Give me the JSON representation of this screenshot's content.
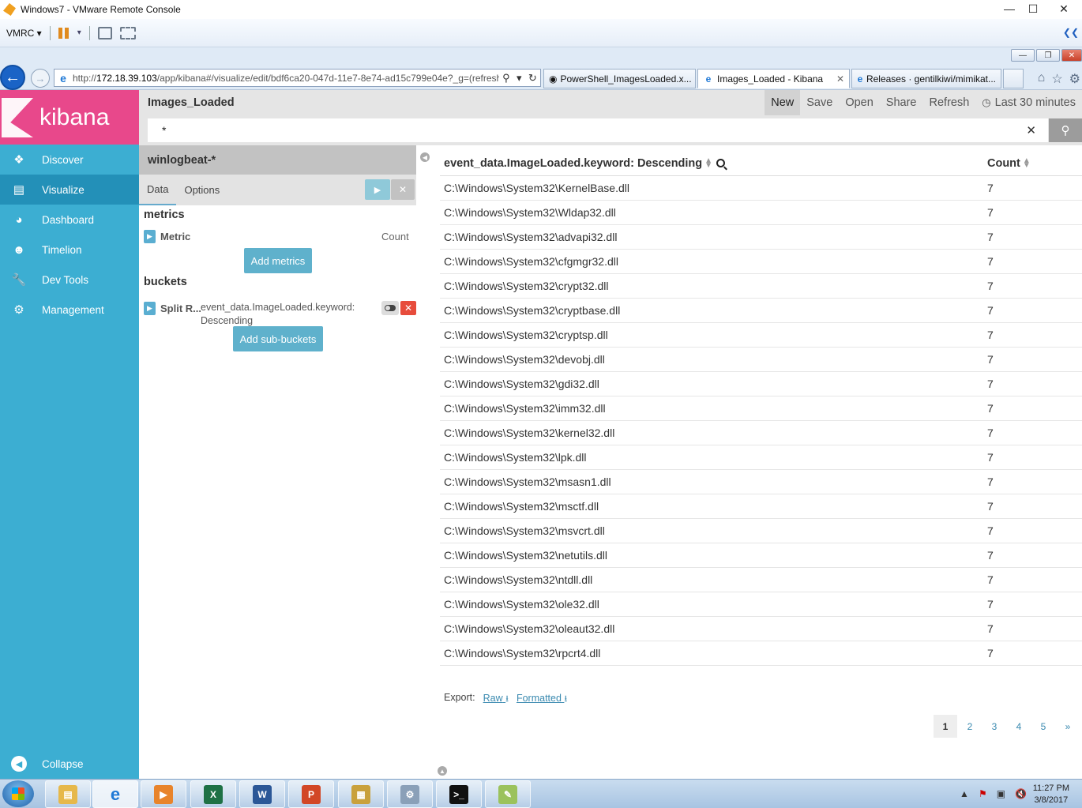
{
  "window": {
    "title": "Windows7 - VMware Remote Console"
  },
  "vm_toolbar": {
    "menu_label": "VMRC"
  },
  "browser": {
    "address_prefix": "http://",
    "address_host": "172.18.39.103",
    "address_path": "/app/kibana#/visualize/edit/bdf6ca20-047d-11e7-8e74-ad15c799e04e?_g=(refresh",
    "tabs": [
      {
        "label": "PowerShell_ImagesLoaded.x...",
        "icon": "github-icon",
        "active": false
      },
      {
        "label": "Images_Loaded - Kibana",
        "icon": "ie-icon",
        "active": true
      },
      {
        "label": "Releases · gentilkiwi/mimikat...",
        "icon": "ie-icon",
        "active": false
      }
    ]
  },
  "kibana": {
    "brand": "kibana",
    "nav": [
      {
        "label": "Discover",
        "icon": "compass-icon",
        "active": false
      },
      {
        "label": "Visualize",
        "icon": "bar-chart-icon",
        "active": true
      },
      {
        "label": "Dashboard",
        "icon": "dashboard-icon",
        "active": false
      },
      {
        "label": "Timelion",
        "icon": "timelion-icon",
        "active": false
      },
      {
        "label": "Dev Tools",
        "icon": "wrench-icon",
        "active": false
      },
      {
        "label": "Management",
        "icon": "gear-icon",
        "active": false
      }
    ],
    "collapse_label": "Collapse",
    "vis_title": "Images_Loaded",
    "menu": [
      "New",
      "Save",
      "Open",
      "Share",
      "Refresh"
    ],
    "time_range": "Last 30 minutes",
    "query": "*",
    "index_pattern": "winlogbeat-*",
    "editor_tabs": [
      "Data",
      "Options"
    ],
    "metrics_heading": "metrics",
    "metric": {
      "label": "Metric",
      "value": "Count"
    },
    "add_metrics_label": "Add metrics",
    "buckets_heading": "buckets",
    "bucket": {
      "label": "Split R...",
      "field_line1": "event_data.ImageLoaded.keyword:",
      "field_line2": "Descending"
    },
    "add_sub_buckets_label": "Add sub-buckets"
  },
  "table": {
    "headers": [
      "event_data.ImageLoaded.keyword: Descending",
      "Count"
    ],
    "rows": [
      [
        "C:\\Windows\\System32\\KernelBase.dll",
        "7"
      ],
      [
        "C:\\Windows\\System32\\Wldap32.dll",
        "7"
      ],
      [
        "C:\\Windows\\System32\\advapi32.dll",
        "7"
      ],
      [
        "C:\\Windows\\System32\\cfgmgr32.dll",
        "7"
      ],
      [
        "C:\\Windows\\System32\\crypt32.dll",
        "7"
      ],
      [
        "C:\\Windows\\System32\\cryptbase.dll",
        "7"
      ],
      [
        "C:\\Windows\\System32\\cryptsp.dll",
        "7"
      ],
      [
        "C:\\Windows\\System32\\devobj.dll",
        "7"
      ],
      [
        "C:\\Windows\\System32\\gdi32.dll",
        "7"
      ],
      [
        "C:\\Windows\\System32\\imm32.dll",
        "7"
      ],
      [
        "C:\\Windows\\System32\\kernel32.dll",
        "7"
      ],
      [
        "C:\\Windows\\System32\\lpk.dll",
        "7"
      ],
      [
        "C:\\Windows\\System32\\msasn1.dll",
        "7"
      ],
      [
        "C:\\Windows\\System32\\msctf.dll",
        "7"
      ],
      [
        "C:\\Windows\\System32\\msvcrt.dll",
        "7"
      ],
      [
        "C:\\Windows\\System32\\netutils.dll",
        "7"
      ],
      [
        "C:\\Windows\\System32\\ntdll.dll",
        "7"
      ],
      [
        "C:\\Windows\\System32\\ole32.dll",
        "7"
      ],
      [
        "C:\\Windows\\System32\\oleaut32.dll",
        "7"
      ],
      [
        "C:\\Windows\\System32\\rpcrt4.dll",
        "7"
      ]
    ],
    "export_label": "Export:",
    "export_raw": "Raw",
    "export_formatted": "Formatted",
    "pages": [
      "1",
      "2",
      "3",
      "4",
      "5",
      "»"
    ],
    "current_page": "1"
  },
  "taskbar": {
    "apps": [
      "explorer-icon",
      "ie-icon",
      "media-player-icon",
      "excel-icon",
      "word-icon",
      "powerpoint-icon",
      "archive-icon",
      "settings-icon",
      "cmd-icon",
      "notepad-icon"
    ],
    "time": "11:27 PM",
    "date": "3/8/2017"
  },
  "colors": {
    "kibana_pink": "#e8488b",
    "sidebar_blue": "#3caed2",
    "link_blue": "#3a8ab0"
  }
}
